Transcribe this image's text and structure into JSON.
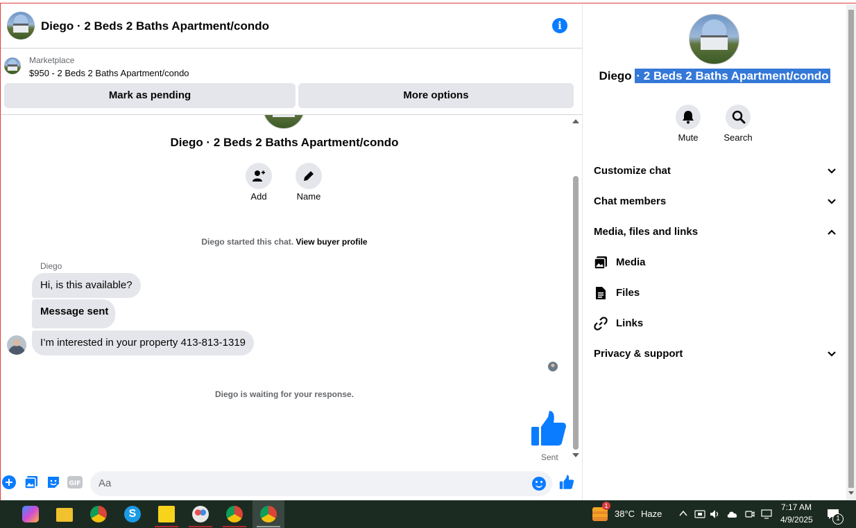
{
  "chat": {
    "header_title": "Diego · 2 Beds 2 Baths Apartment/condo",
    "marketplace_label": "Marketplace",
    "listing_price": "$950 - 2 Beds 2 Baths Apartment/condo",
    "mark_pending_label": "Mark as pending",
    "more_options_label": "More options",
    "conversation_title": "Diego · 2 Beds 2 Baths Apartment/condo",
    "add_label": "Add",
    "name_label": "Name",
    "started_text": "Diego started this chat.",
    "view_profile_link": "View buyer profile",
    "sender_name": "Diego",
    "messages": [
      "Hi, is this available?",
      "Message sent",
      "I’m interested in your property 413-813-1319"
    ],
    "waiting_text": "Diego is waiting for your response.",
    "sent_status": "Sent",
    "composer_placeholder": "Aa",
    "accent_color": "#0a7cff"
  },
  "panel": {
    "title_plain": "Diego ",
    "title_selected": "· 2 Beds 2 Baths Apartment/condo",
    "mute_label": "Mute",
    "search_label": "Search",
    "sections": {
      "customize": "Customize chat",
      "members": "Chat members",
      "media_files_links": "Media, files and links",
      "privacy": "Privacy & support"
    },
    "sub_items": {
      "media": "Media",
      "files": "Files",
      "links": "Links"
    }
  },
  "taskbar": {
    "weather_temp": "38°C",
    "weather_desc": "Haze",
    "weather_badge": "1",
    "time": "7:17 AM",
    "date": "4/9/2025",
    "notification_count": "1"
  }
}
